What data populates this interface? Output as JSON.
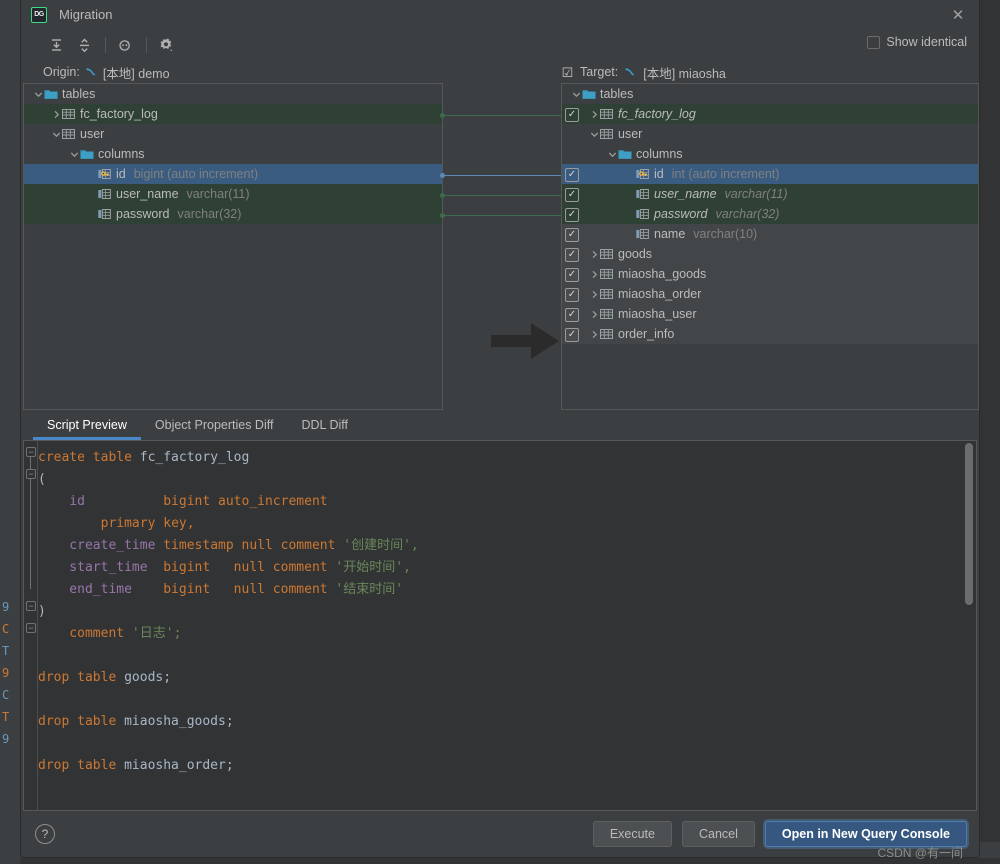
{
  "window": {
    "title": "Migration",
    "logo_text": "DG",
    "close_icon": "✕"
  },
  "toolbar": {
    "expand_all": "expand-all",
    "collapse_all": "collapse-all",
    "refresh": "refresh",
    "settings": "settings",
    "show_identical_label": "Show identical",
    "show_identical_checked": false
  },
  "origin": {
    "label": "Origin:",
    "connection": "[本地] demo"
  },
  "target": {
    "label": "Target:",
    "connection": "[本地] miaosha",
    "checked": true,
    "check_mark": "☑"
  },
  "left_tree": [
    {
      "indent": 0,
      "twisty": "v",
      "icon": "folder-icon",
      "name": "tables",
      "type": "",
      "state": "normal"
    },
    {
      "indent": 1,
      "twisty": ">",
      "icon": "table-icon",
      "name": "fc_factory_log",
      "type": "",
      "state": "green"
    },
    {
      "indent": 1,
      "twisty": "v",
      "icon": "table-icon",
      "name": "user",
      "type": "",
      "state": "normal"
    },
    {
      "indent": 2,
      "twisty": "v",
      "icon": "folder-icon",
      "name": "columns",
      "type": "",
      "state": "normal"
    },
    {
      "indent": 3,
      "twisty": "",
      "icon": "pk-column-icon",
      "name": "id",
      "type": "bigint (auto increment)",
      "state": "selected"
    },
    {
      "indent": 3,
      "twisty": "",
      "icon": "column-icon",
      "name": "user_name",
      "type": "varchar(11)",
      "state": "green"
    },
    {
      "indent": 3,
      "twisty": "",
      "icon": "column-icon",
      "name": "password",
      "type": "varchar(32)",
      "state": "green"
    }
  ],
  "right_tree": [
    {
      "indent": 0,
      "twisty": "v",
      "icon": "folder-icon",
      "name": "tables",
      "type": "",
      "state": "normal",
      "italic": false,
      "checkbox": false
    },
    {
      "indent": 1,
      "twisty": ">",
      "icon": "table-icon",
      "name": "fc_factory_log",
      "type": "",
      "state": "green",
      "italic": true,
      "checkbox": true
    },
    {
      "indent": 1,
      "twisty": "v",
      "icon": "table-icon",
      "name": "user",
      "type": "",
      "state": "normal",
      "italic": false,
      "checkbox": false
    },
    {
      "indent": 2,
      "twisty": "v",
      "icon": "folder-icon",
      "name": "columns",
      "type": "",
      "state": "normal",
      "italic": false,
      "checkbox": false
    },
    {
      "indent": 3,
      "twisty": "",
      "icon": "pk-column-icon",
      "name": "id",
      "type": "int (auto increment)",
      "state": "selected",
      "italic": false,
      "checkbox": true
    },
    {
      "indent": 3,
      "twisty": "",
      "icon": "column-icon",
      "name": "user_name",
      "type": "varchar(11)",
      "state": "green",
      "italic": true,
      "checkbox": true
    },
    {
      "indent": 3,
      "twisty": "",
      "icon": "column-icon",
      "name": "password",
      "type": "varchar(32)",
      "state": "green",
      "italic": true,
      "checkbox": true
    },
    {
      "indent": 3,
      "twisty": "",
      "icon": "column-icon",
      "name": "name",
      "type": "varchar(10)",
      "state": "grey",
      "italic": false,
      "checkbox": true
    },
    {
      "indent": 1,
      "twisty": ">",
      "icon": "table-icon",
      "name": "goods",
      "type": "",
      "state": "grey",
      "italic": false,
      "checkbox": true
    },
    {
      "indent": 1,
      "twisty": ">",
      "icon": "table-icon",
      "name": "miaosha_goods",
      "type": "",
      "state": "grey",
      "italic": false,
      "checkbox": true
    },
    {
      "indent": 1,
      "twisty": ">",
      "icon": "table-icon",
      "name": "miaosha_order",
      "type": "",
      "state": "grey",
      "italic": false,
      "checkbox": true
    },
    {
      "indent": 1,
      "twisty": ">",
      "icon": "table-icon",
      "name": "miaosha_user",
      "type": "",
      "state": "grey",
      "italic": false,
      "checkbox": true
    },
    {
      "indent": 1,
      "twisty": ">",
      "icon": "table-icon",
      "name": "order_info",
      "type": "",
      "state": "grey",
      "italic": false,
      "checkbox": true
    }
  ],
  "tabs": [
    {
      "label": "Script Preview",
      "active": true
    },
    {
      "label": "Object Properties Diff",
      "active": false
    },
    {
      "label": "DDL Diff",
      "active": false
    }
  ],
  "script": {
    "lines": [
      [
        {
          "t": "create table ",
          "c": "k"
        },
        {
          "t": "fc_factory_log",
          "c": "id"
        }
      ],
      [
        {
          "t": "(",
          "c": "p"
        }
      ],
      [
        {
          "t": "    id          ",
          "c": "c1"
        },
        {
          "t": "bigint auto_increment",
          "c": "k"
        }
      ],
      [
        {
          "t": "        ",
          "c": "p"
        },
        {
          "t": "primary key,",
          "c": "k"
        }
      ],
      [
        {
          "t": "    create_time ",
          "c": "c1"
        },
        {
          "t": "timestamp null comment ",
          "c": "k"
        },
        {
          "t": "'创建时间',",
          "c": "s"
        }
      ],
      [
        {
          "t": "    start_time  ",
          "c": "c1"
        },
        {
          "t": "bigint   null comment ",
          "c": "k"
        },
        {
          "t": "'开始时间',",
          "c": "s"
        }
      ],
      [
        {
          "t": "    end_time    ",
          "c": "c1"
        },
        {
          "t": "bigint   null comment ",
          "c": "k"
        },
        {
          "t": "'结束时间'",
          "c": "s"
        }
      ],
      [
        {
          "t": ")",
          "c": "p"
        }
      ],
      [
        {
          "t": "    comment ",
          "c": "k"
        },
        {
          "t": "'日志';",
          "c": "s"
        }
      ],
      [
        {
          "t": "",
          "c": "p"
        }
      ],
      [
        {
          "t": "drop table ",
          "c": "k"
        },
        {
          "t": "goods;",
          "c": "id"
        }
      ],
      [
        {
          "t": "",
          "c": "p"
        }
      ],
      [
        {
          "t": "drop table ",
          "c": "k"
        },
        {
          "t": "miaosha_goods;",
          "c": "id"
        }
      ],
      [
        {
          "t": "",
          "c": "p"
        }
      ],
      [
        {
          "t": "drop table ",
          "c": "k"
        },
        {
          "t": "miaosha_order;",
          "c": "id"
        }
      ]
    ]
  },
  "footer": {
    "help_label": "?",
    "execute": "Execute",
    "cancel": "Cancel",
    "open_console": "Open in New Query Console"
  },
  "watermark": "CSDN @有一间",
  "backdrop_code": [
    "9",
    "C",
    "",
    "T",
    "9",
    "C",
    "",
    "T",
    "9"
  ],
  "backdrop_bottom_text": "",
  "colors": {
    "accent_tab": "#4a88c7",
    "selection": "#3a5c80",
    "added_green": "#2f4034",
    "primary_button": "#365880",
    "keyword": "#cc7832",
    "string": "#6a8759",
    "column": "#9876aa",
    "identifier": "#a9b7c6"
  }
}
